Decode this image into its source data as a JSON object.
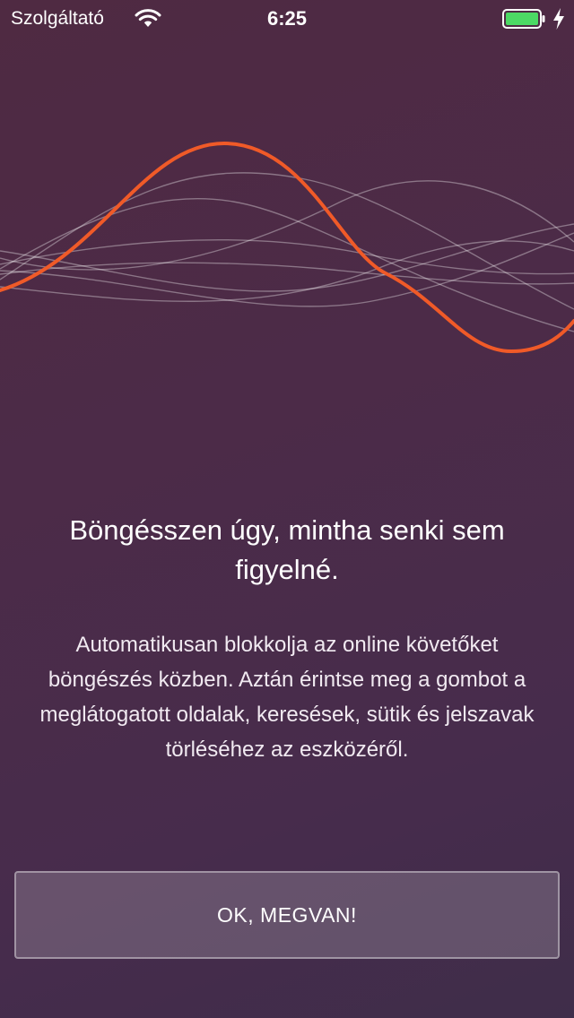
{
  "status_bar": {
    "carrier": "Szolgáltató",
    "time": "6:25",
    "wifi_icon": "wifi-icon",
    "battery_icon": "battery-full-icon",
    "charging_icon": "bolt-icon",
    "battery_color": "#4cd964"
  },
  "illustration": {
    "icon": "sine-waves-illustration",
    "accent_color": "#f05a28"
  },
  "onboarding": {
    "title": "Böngésszen úgy, mintha senki sem figyelné.",
    "description": "Automatikusan blokkolja az online követőket böngészés közben. Aztán érintse meg a gombot a meglátogatott oldalak, keresések, sütik és jelszavak törléséhez az eszközéről."
  },
  "actions": {
    "ok_label": "OK, MEGVAN!"
  }
}
